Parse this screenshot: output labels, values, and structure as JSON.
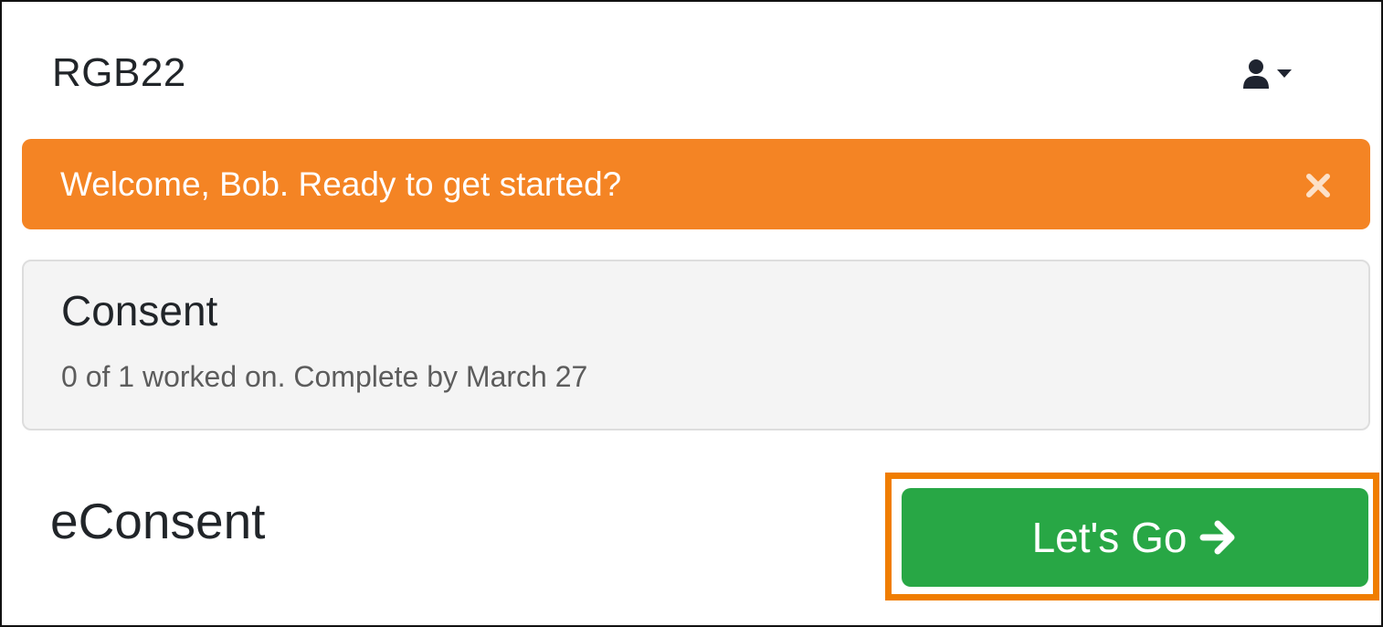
{
  "header": {
    "brand": "RGB22",
    "user_menu_icon": "user-icon",
    "dropdown_icon": "caret-down-icon"
  },
  "alert": {
    "message": "Welcome, Bob. Ready to get started?",
    "close_icon": "close-icon",
    "color": "#f48424"
  },
  "consent_card": {
    "title": "Consent",
    "status": "0 of 1 worked on. Complete by March 27"
  },
  "section": {
    "title": "eConsent"
  },
  "action": {
    "label": "Let's Go",
    "icon": "arrow-right-icon",
    "color": "#28a745",
    "highlight_color": "#f07d00"
  }
}
